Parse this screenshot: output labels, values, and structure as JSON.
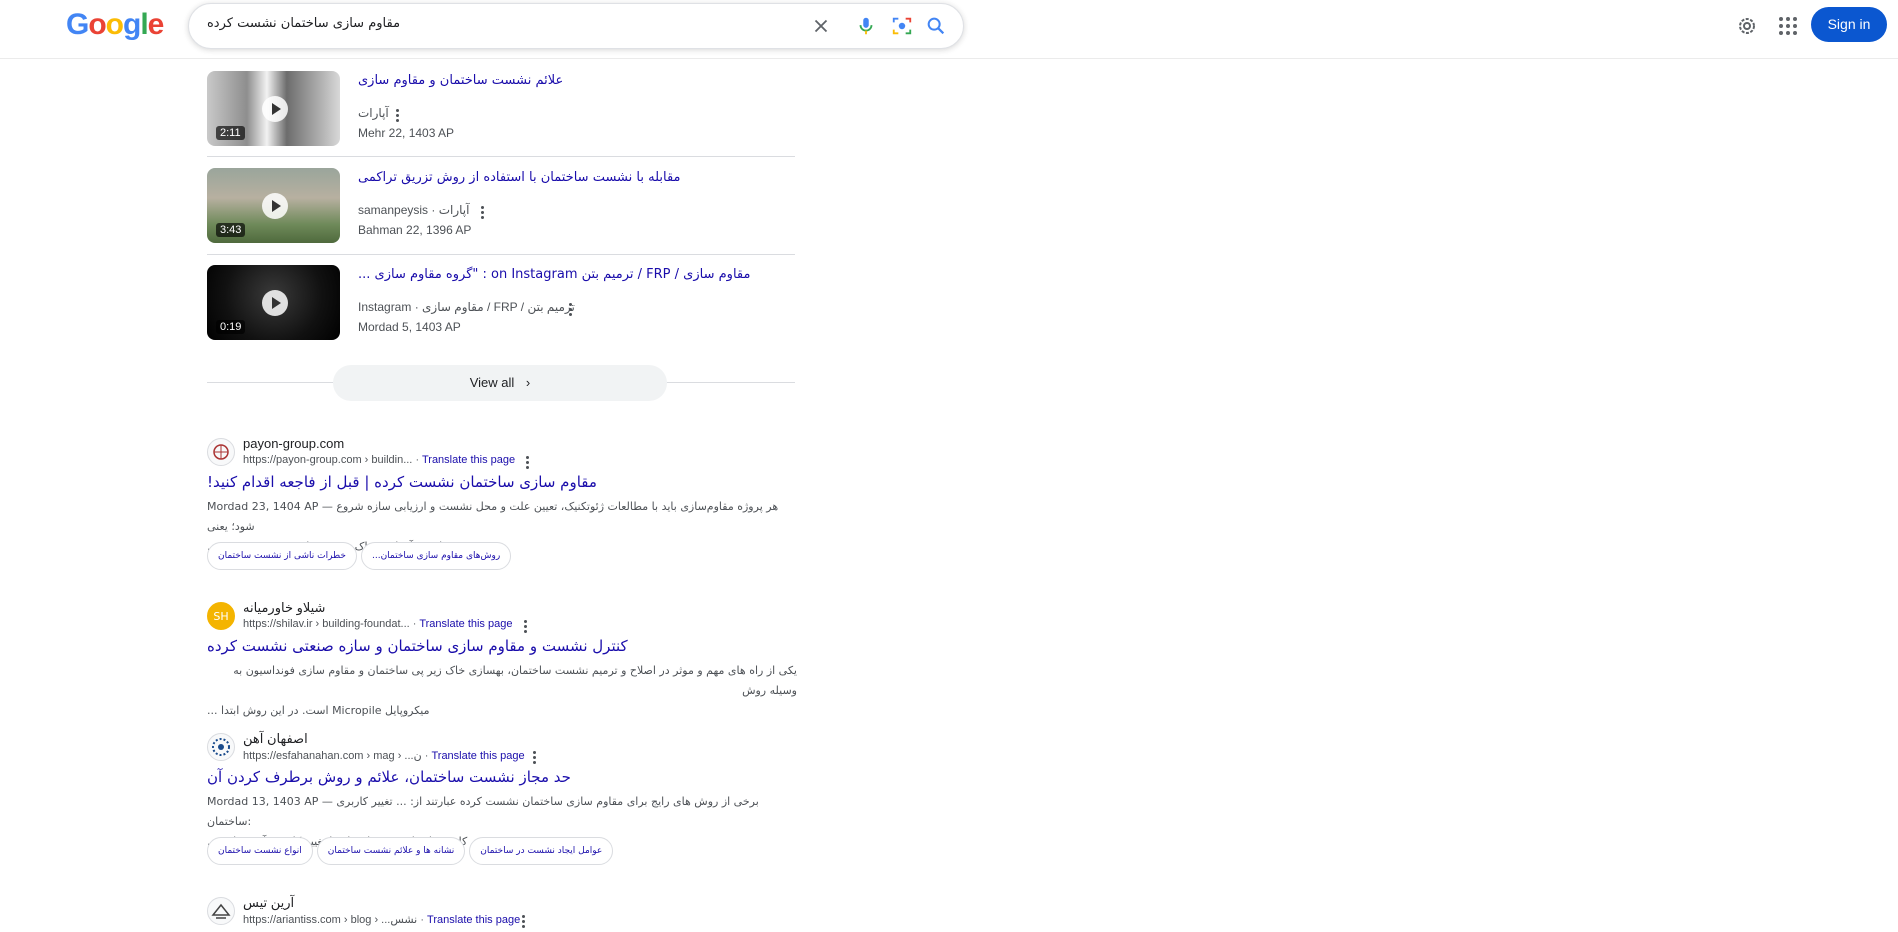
{
  "header": {
    "logo_letters": [
      {
        "ch": "G",
        "color": "#4285F4"
      },
      {
        "ch": "o",
        "color": "#EA4335"
      },
      {
        "ch": "o",
        "color": "#FBBC05"
      },
      {
        "ch": "g",
        "color": "#4285F4"
      },
      {
        "ch": "l",
        "color": "#34A853"
      },
      {
        "ch": "e",
        "color": "#EA4335"
      }
    ],
    "query": "مقاوم سازی ساختمان نشست کرده",
    "sign_in": "Sign in",
    "icons": [
      "close-icon",
      "microphone-icon",
      "camera-search-icon",
      "search-icon",
      "settings-gear-icon",
      "apps-grid-icon"
    ]
  },
  "videos": [
    {
      "title": "علائم نشست ساختمان و مقاوم سازی",
      "source": "آپارات",
      "date": "Mehr 22, 1403 AP",
      "duration": "2:11"
    },
    {
      "title": "مقابله با نشست ساختمان با استفاده از روش تزریق تراکمی",
      "source": "samanpeysis · آپارات",
      "date": "Bahman 22, 1396 AP",
      "duration": "3:43"
    },
    {
      "title": "مقاوم سازی / FRP / ترمیم بتن on Instagram : \"گروه مقاوم سازی ...",
      "source": "Instagram · مقاوم سازی / FRP / ترمیم بتن",
      "date": "Mordad 5, 1403 AP",
      "duration": "0:19"
    }
  ],
  "view_all": "View all",
  "results": [
    {
      "site": "payon-group.com",
      "url": "https://payon-group.com › buildin...",
      "translate": "Translate this page",
      "title": "مقاوم سازی ساختمان نشست کرده | قبل از فاجعه اقدام کنید!",
      "date": "Mordad 23, 1404 AP —",
      "snippet_1": "هر پروژه مقاوم‌سازی باید با مطالعات ژئوتکنیک، تعیین علت و محل نشست و ارزیابی سازه شروع شود؛ یعنی",
      "snippet_2": "حفاری و آزمایش خاک، نقشه‌برداری دقیق و بررسی ...",
      "chips": [
        "خطرات ناشی از نشست ساختمان",
        "روش‌های مقاوم سازی ساختمان..."
      ]
    },
    {
      "site": "شیلاو خاورمیانه",
      "url": "https://shilav.ir › building-foundat...",
      "translate": "Translate this page",
      "title": "کنترل نشست و مقاوم سازی ساختمان و سازه صنعتی نشست کرده",
      "snippet_1": "یکی از راه های مهم و موثر در اصلاح و ترمیم نشست ساختمان، بهسازی خاک زیر پی ساختمان و مقاوم سازی فونداسیون به وسیله روش",
      "snippet_2": "میکروپایل Micropile است. در این روش ابتدا ..."
    },
    {
      "site": "اصفهان آهن",
      "url": "https://esfahanahan.com › mag › ...ن",
      "translate": "Translate this page",
      "title": "حد مجاز نشست ساختمان، علائم و روش برطرف کردن آن",
      "date": "Mordad 13, 1403 AP —",
      "snippet_1": "برخی از روش های رایج برای مقاوم سازی ساختمان نشست کرده عبارتند از: ... تغییر کاربری ساختمان:",
      "snippet_2": "کاهش بار وارده بر ساختمان با تغییر کاربری آن. مقاوم ...",
      "chips": [
        "انواع نشست ساختمان",
        "نشانه ها و علائم نشست ساختمان",
        "عوامل ایجاد نشست در ساختمان"
      ]
    },
    {
      "site": "آرین تیس",
      "url": "https://ariantiss.com › blog › ...نشس",
      "translate": "Translate this page"
    }
  ]
}
